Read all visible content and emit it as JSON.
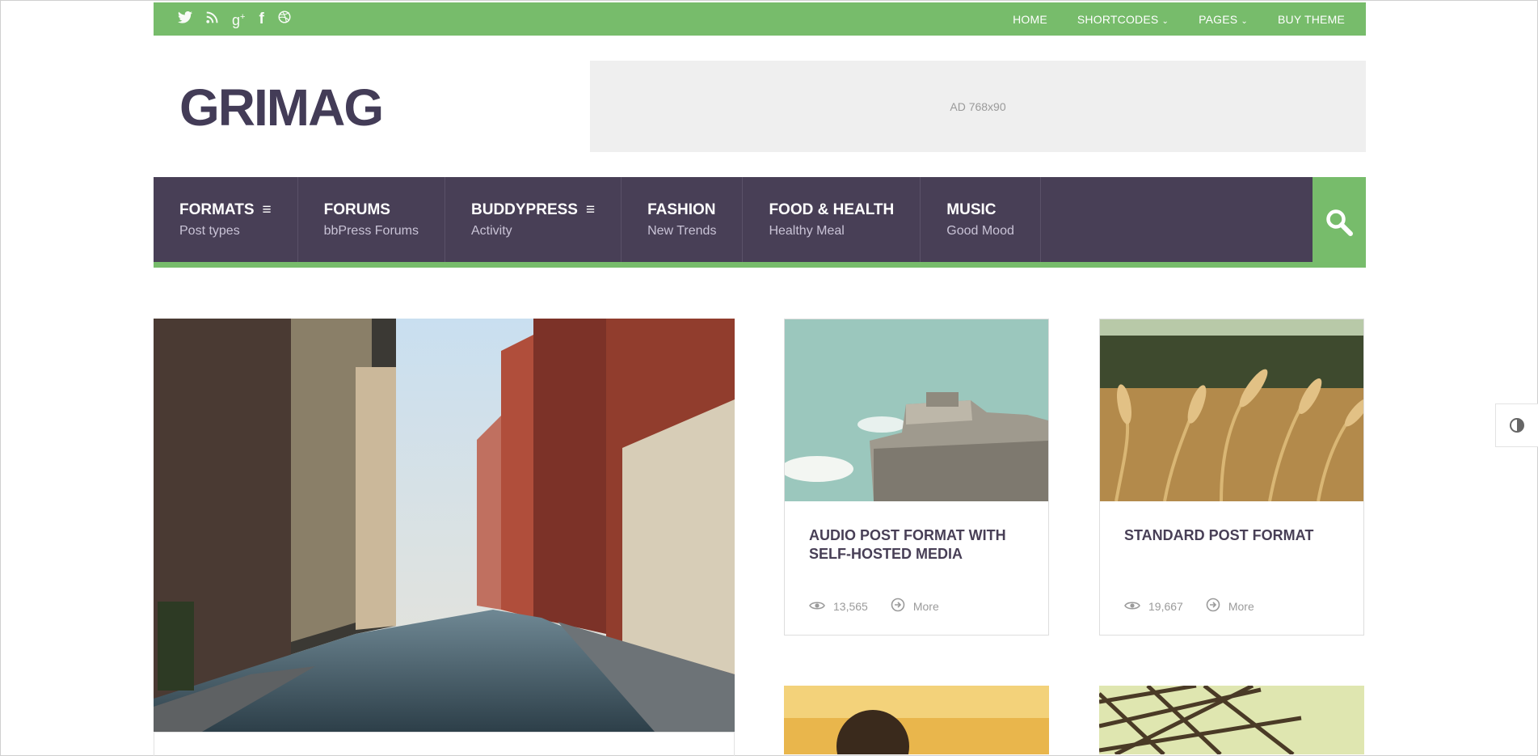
{
  "topbar": {
    "social": [
      "twitter-icon",
      "rss-icon",
      "google-plus-icon",
      "facebook-icon",
      "dribbble-icon"
    ],
    "nav": [
      {
        "label": "HOME",
        "dropdown": false
      },
      {
        "label": "SHORTCODES",
        "dropdown": true
      },
      {
        "label": "PAGES",
        "dropdown": true
      },
      {
        "label": "BUY THEME",
        "dropdown": false
      }
    ]
  },
  "header": {
    "logo": "GRIMAG",
    "ad": "AD 768x90"
  },
  "mainnav": {
    "items": [
      {
        "title": "FORMATS",
        "subtitle": "Post types",
        "menu": true
      },
      {
        "title": "FORUMS",
        "subtitle": "bbPress Forums",
        "menu": false
      },
      {
        "title": "BUDDYPRESS",
        "subtitle": "Activity",
        "menu": true
      },
      {
        "title": "FASHION",
        "subtitle": "New Trends",
        "menu": false
      },
      {
        "title": "FOOD & HEALTH",
        "subtitle": "Healthy Meal",
        "menu": false
      },
      {
        "title": "MUSIC",
        "subtitle": "Good Mood",
        "menu": false
      }
    ]
  },
  "posts": [
    {
      "title": "AUDIO POST FORMAT WITH SELF-HOSTED MEDIA",
      "views": "13,565",
      "more": "More"
    },
    {
      "title": "STANDARD POST FORMAT",
      "views": "19,667",
      "more": "More"
    }
  ],
  "colors": {
    "accent": "#77bc6b",
    "nav_bg": "#483f56",
    "logo": "#433c57"
  }
}
